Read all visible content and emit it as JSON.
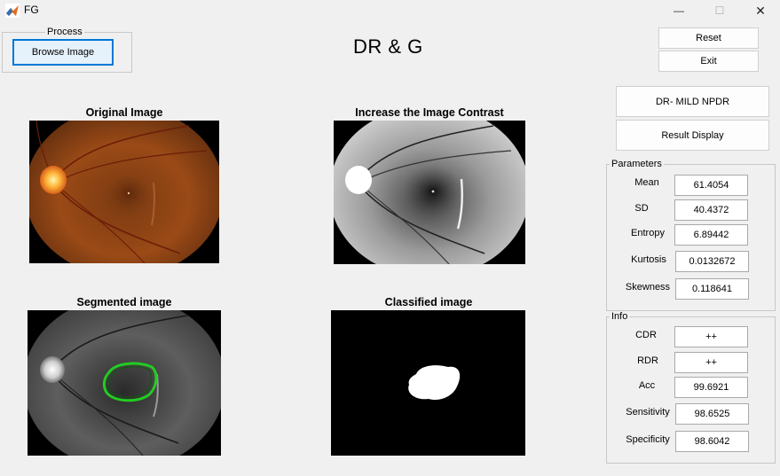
{
  "window": {
    "title": "FG",
    "icon": "matlab-icon"
  },
  "window_controls": {
    "minimize": "—",
    "maximize": "☐",
    "close": "✕"
  },
  "process": {
    "legend": "Process",
    "browse_label": "Browse Image"
  },
  "main_title": "DR & G",
  "actions": {
    "reset_label": "Reset",
    "exit_label": "Exit"
  },
  "result": {
    "diagnosis": "DR- MILD NPDR",
    "display_label": "Result Display"
  },
  "images": {
    "original": "Original Image",
    "contrast": "Increase the Image Contrast",
    "segmented": "Segmented image",
    "classified": "Classified image"
  },
  "parameters": {
    "legend": "Parameters",
    "rows": [
      {
        "label": "Mean",
        "value": "61.4054"
      },
      {
        "label": "SD",
        "value": "40.4372"
      },
      {
        "label": "Entropy",
        "value": "6.89442"
      },
      {
        "label": "Kurtosis",
        "value": "0.0132672"
      },
      {
        "label": "Skewness",
        "value": "0.118641"
      }
    ]
  },
  "info": {
    "legend": "Info",
    "rows": [
      {
        "label": "CDR",
        "value": "++"
      },
      {
        "label": "RDR",
        "value": "++"
      },
      {
        "label": "Acc",
        "value": "99.6921"
      },
      {
        "label": "Sensitivity",
        "value": "98.6525"
      },
      {
        "label": "Specificity",
        "value": "98.6042"
      }
    ]
  },
  "colors": {
    "accent": "#0078d7",
    "segment_outline": "#22cc22"
  }
}
